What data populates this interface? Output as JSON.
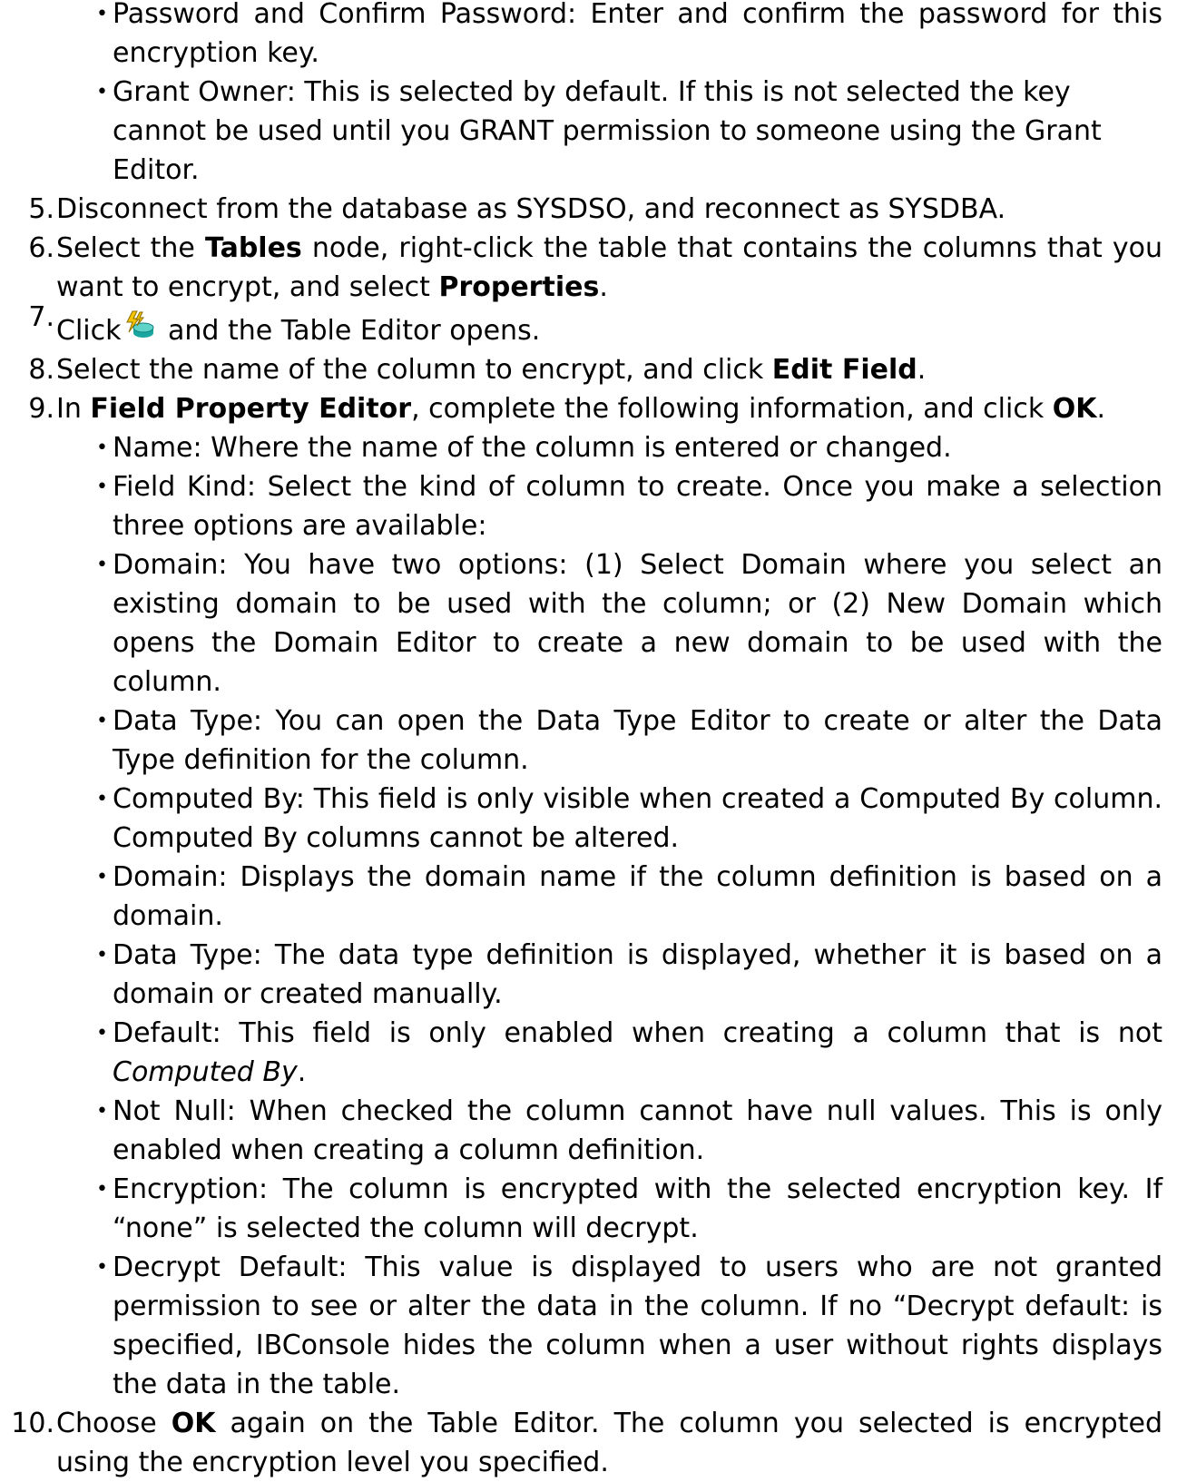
{
  "top_bullets": [
    {
      "text": "Password and Confirm Password: Enter and confirm the password for this encryption key."
    },
    {
      "text": "Grant Owner: This is selected by default. If this is not selected the key cannot be used until you GRANT permission to someone using the Grant Editor."
    }
  ],
  "steps": {
    "s5": {
      "num": "5.",
      "text": "Disconnect from the database as SYSDSO, and reconnect as SYSDBA."
    },
    "s6": {
      "num": "6.",
      "a": "Select the ",
      "b1": "Tables",
      "c": " node, right-click the table that contains the columns that you want to encrypt, and select ",
      "b2": "Properties",
      "d": "."
    },
    "s7": {
      "num": "7.",
      "a": "Click",
      "icon": "table-editor-icon",
      "b": " and the Table Editor opens."
    },
    "s8": {
      "num": "8.",
      "a": "Select the name of the column to encrypt, and click ",
      "b1": "Edit Field",
      "c": "."
    },
    "s9": {
      "num": "9.",
      "a": "In ",
      "b1": "Field Property Editor",
      "c": ", complete the following information, and click ",
      "b2": "OK",
      "d": "."
    },
    "s10": {
      "num": "10.",
      "a": "Choose ",
      "b1": "OK",
      "c": " again on the Table Editor. The column you selected is encrypted using the encryption level you specified."
    }
  },
  "field_bullets": {
    "name": "Name: Where the name of the column is entered or changed.",
    "field_kind": "Field Kind: Select the kind of column to create. Once you make a selection three options are available:",
    "domain_opts": "Domain: You have two options: (1) Select Domain where you select an existing domain to be used with the column; or (2) New Domain which opens the Domain Editor to create a new domain to be used with the column.",
    "data_type_editor": "Data Type: You can open the Data Type Editor to create or alter the Data Type definition for the column.",
    "computed_by": "Computed By: This field is only visible when created a Computed By column. Computed By columns cannot be altered.",
    "domain_display": "Domain: Displays the domain name if the column definition is based on a domain.",
    "data_type_display": "Data Type: The data type definition is displayed, whether it is based on a domain or created manually.",
    "default_a": "Default: This field is only enabled when creating a column that is not ",
    "default_i": "Computed By",
    "default_b": ".",
    "not_null": "Not Null: When checked the column cannot have null values. This is only enabled when creating a column definition.",
    "encryption": "Encryption: The column is encrypted with the selected encryption key. If “none” is selected the column will decrypt.",
    "decrypt_default": "Decrypt Default: This value is displayed to users who are not granted permission to see or alter the data in the column. If no “Decrypt default: is specified, IBConsole hides the column when a user without rights displays the data in the table."
  },
  "colors": {
    "text": "#000000",
    "background": "#ffffff",
    "icon_yellow": "#f5c400",
    "icon_teal": "#1aa6a0"
  }
}
